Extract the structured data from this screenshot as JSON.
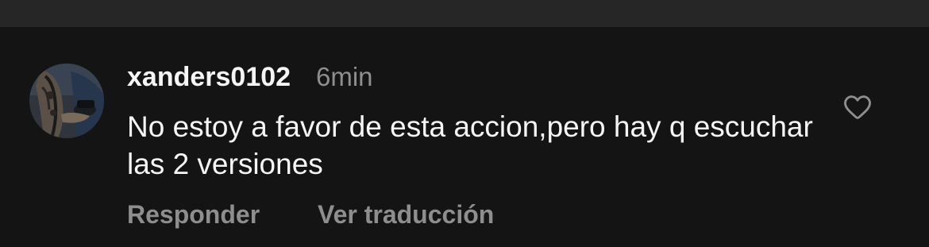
{
  "comment": {
    "username": "xanders0102",
    "timestamp": "6min",
    "text": "No estoy a favor de esta accion,pero hay q escuchar las 2 versiones",
    "actions": {
      "reply_label": "Responder",
      "translate_label": "Ver traducción"
    },
    "like_icon": "heart-outline-icon",
    "avatar_icon": "user-avatar"
  },
  "colors": {
    "background": "#141414",
    "top_bar": "#262626",
    "primary_text": "#f5f5f5",
    "secondary_text": "#8e8e8e"
  }
}
